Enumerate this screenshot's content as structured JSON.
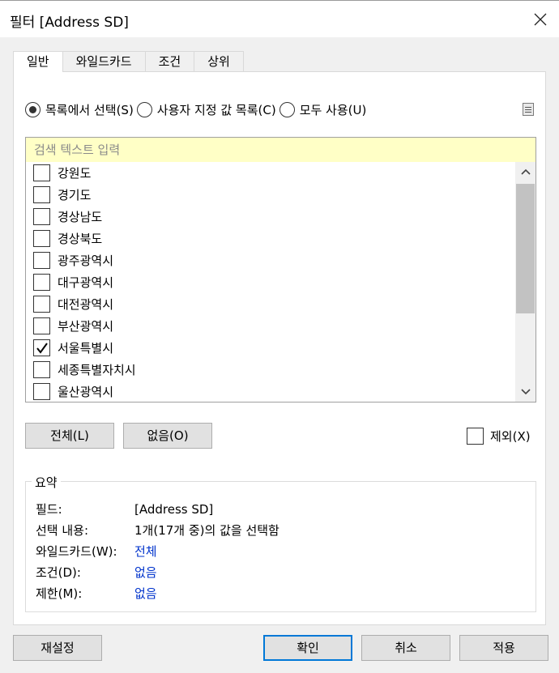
{
  "window": {
    "title": "필터 [Address SD]"
  },
  "tabs": [
    {
      "label": "일반",
      "active": true
    },
    {
      "label": "와일드카드",
      "active": false
    },
    {
      "label": "조건",
      "active": false
    },
    {
      "label": "상위",
      "active": false
    }
  ],
  "mode": {
    "options": [
      {
        "label": "목록에서 선택(S)",
        "selected": true
      },
      {
        "label": "사용자 지정 값 목록(C)",
        "selected": false
      },
      {
        "label": "모두 사용(U)",
        "selected": false
      }
    ]
  },
  "search": {
    "placeholder": "검색 텍스트 입력"
  },
  "list": {
    "items": [
      {
        "label": "강원도",
        "checked": false
      },
      {
        "label": "경기도",
        "checked": false
      },
      {
        "label": "경상남도",
        "checked": false
      },
      {
        "label": "경상북도",
        "checked": false
      },
      {
        "label": "광주광역시",
        "checked": false
      },
      {
        "label": "대구광역시",
        "checked": false
      },
      {
        "label": "대전광역시",
        "checked": false
      },
      {
        "label": "부산광역시",
        "checked": false
      },
      {
        "label": "서울특별시",
        "checked": true
      },
      {
        "label": "세종특별자치시",
        "checked": false
      },
      {
        "label": "울산광역시",
        "checked": false
      }
    ]
  },
  "actions": {
    "all_label": "전체(L)",
    "none_label": "없음(O)",
    "exclude_label": "제외(X)",
    "exclude_checked": false
  },
  "summary": {
    "legend": "요약",
    "rows": [
      {
        "label": "필드:",
        "value": "[Address SD]",
        "link": false
      },
      {
        "label": "선택 내용:",
        "value": "1개(17개 중)의 값을 선택함",
        "link": false
      },
      {
        "label": "와일드카드(W):",
        "value": "전체",
        "link": true
      },
      {
        "label": "조건(D):",
        "value": "없음",
        "link": true
      },
      {
        "label": "제한(M):",
        "value": "없음",
        "link": true
      }
    ]
  },
  "footer": {
    "reset_label": "재설정",
    "ok_label": "확인",
    "cancel_label": "취소",
    "apply_label": "적용"
  },
  "colors": {
    "search_bg": "#ffffc6",
    "link": "#0033cc",
    "focus": "#0078d7"
  }
}
